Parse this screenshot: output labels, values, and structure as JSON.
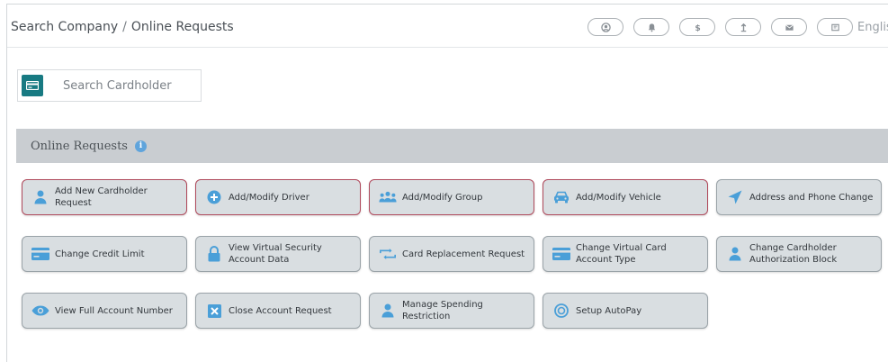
{
  "breadcrumb": {
    "company": "Search Company",
    "separator": "/",
    "page": "Online Requests"
  },
  "header": {
    "icons": [
      "user-icon",
      "bell-icon",
      "dollar-icon",
      "upload-icon",
      "mail-icon",
      "flag-icon"
    ],
    "language": "English"
  },
  "search": {
    "placeholder": "Search Cardholder"
  },
  "panel": {
    "title": "Online Requests",
    "info": "i"
  },
  "requests": [
    {
      "label": "Add New Cardholder Request",
      "icon": "person-icon"
    },
    {
      "label": "Add/Modify Driver",
      "icon": "plus-circle-icon"
    },
    {
      "label": "Add/Modify Group",
      "icon": "group-icon"
    },
    {
      "label": "Add/Modify Vehicle",
      "icon": "car-icon"
    },
    {
      "label": "Address and Phone Change",
      "icon": "location-arrow-icon"
    },
    {
      "label": "Change Credit Limit",
      "icon": "credit-card-icon"
    },
    {
      "label": "View Virtual Security Account Data",
      "icon": "lock-icon"
    },
    {
      "label": "Card Replacement Request",
      "icon": "retweet-icon"
    },
    {
      "label": "Change Virtual Card Account Type",
      "icon": "credit-card-icon"
    },
    {
      "label": "Change Cardholder Authorization Block",
      "icon": "person-icon"
    },
    {
      "label": "View Full Account Number",
      "icon": "eye-icon"
    },
    {
      "label": "Close Account Request",
      "icon": "close-square-icon"
    },
    {
      "label": "Manage Spending Restriction",
      "icon": "person-icon"
    },
    {
      "label": "Setup AutoPay",
      "icon": "autopay-circle-icon"
    }
  ],
  "colors": {
    "accent": "#187a82",
    "icon_blue": "#4a9fd8",
    "button_bg": "#d9dee1",
    "button_border_active": "#b04a5c",
    "panel_header_bg": "#c9cdd1"
  }
}
